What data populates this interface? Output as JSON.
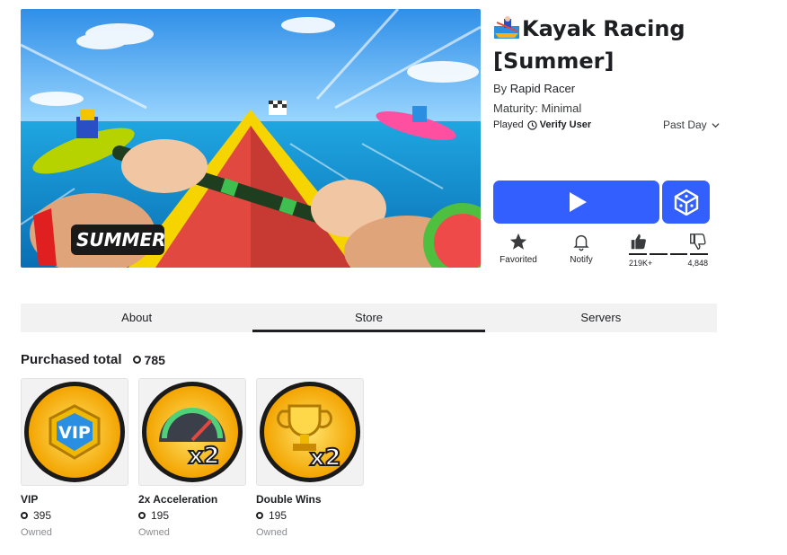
{
  "game": {
    "title": "Kayak Racing [Summer]",
    "by_prefix": "By",
    "creator": "Rapid Racer",
    "maturity": "Maturity: Minimal",
    "played_label": "Played",
    "verify_label": "Verify User",
    "period_label": "Past Day",
    "thumbnail_badge": "SUMMER"
  },
  "actions": {
    "favorite_label": "Favorited",
    "notify_label": "Notify",
    "upvotes": "219K+",
    "downvotes": "4,848"
  },
  "tabs": [
    {
      "label": "About",
      "active": false
    },
    {
      "label": "Store",
      "active": true
    },
    {
      "label": "Servers",
      "active": false
    }
  ],
  "store": {
    "purchased_label": "Purchased total",
    "purchased_total": "785",
    "items": [
      {
        "name": "VIP",
        "price": "395",
        "status": "Owned",
        "icon": "vip-badge-icon"
      },
      {
        "name": "2x Acceleration",
        "price": "195",
        "status": "Owned",
        "icon": "speedometer-x2-icon"
      },
      {
        "name": "Double Wins",
        "price": "195",
        "status": "Owned",
        "icon": "trophy-x2-icon"
      }
    ]
  },
  "colors": {
    "play_button": "#335fff",
    "text_primary": "#1e1f22",
    "tab_bar": "#f2f2f3",
    "muted": "#8a8c8f"
  }
}
